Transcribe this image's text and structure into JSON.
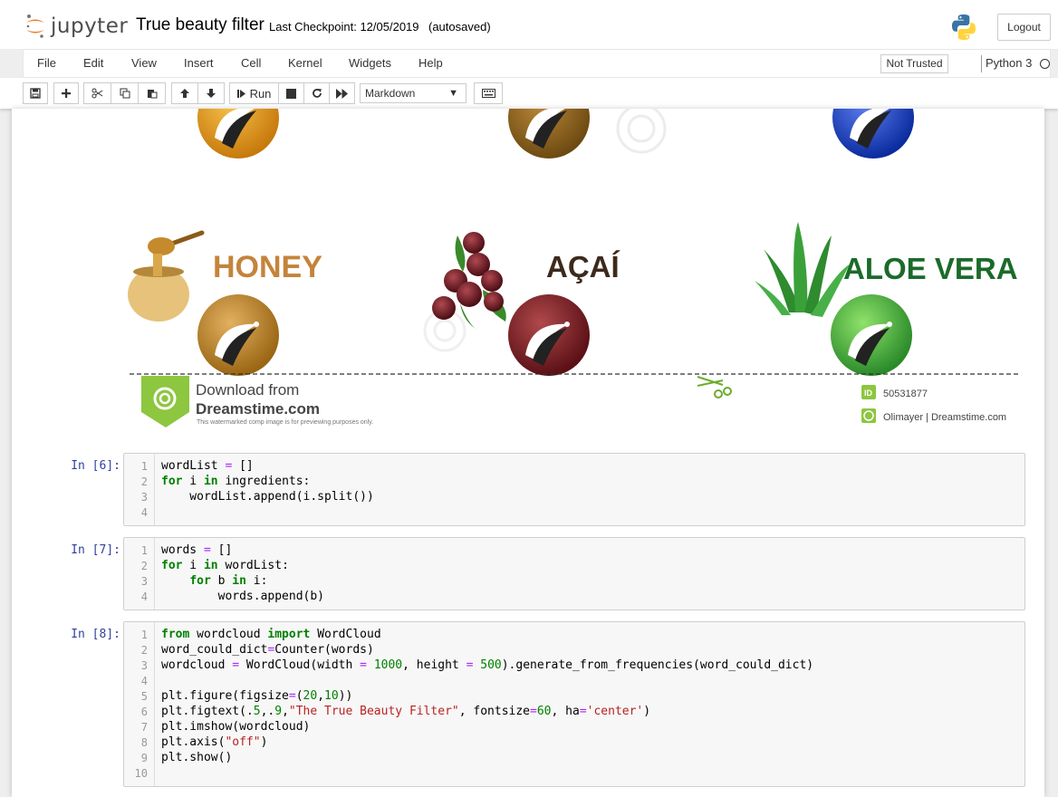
{
  "header": {
    "logo_text": "jupyter",
    "notebook_title": "True beauty filter",
    "checkpoint": "Last Checkpoint: 12/05/2019",
    "autosave": "(autosaved)",
    "logout_label": "Logout"
  },
  "menubar": {
    "items": [
      "File",
      "Edit",
      "View",
      "Insert",
      "Cell",
      "Kernel",
      "Widgets",
      "Help"
    ],
    "trust_label": "Not Trusted",
    "kernel_name": "Python 3"
  },
  "toolbar": {
    "run_label": "Run",
    "cell_type": "Markdown",
    "icons": [
      "save-icon",
      "plus-icon",
      "cut-icon",
      "copy-icon",
      "paste-icon",
      "arrow-up-icon",
      "arrow-down-icon",
      "run-icon",
      "stop-icon",
      "restart-icon",
      "fast-forward-icon",
      "keyboard-icon"
    ]
  },
  "output_image": {
    "labels": [
      "HONEY",
      "AÇAÍ",
      "ALOE VERA"
    ],
    "download_line1": "Download from",
    "download_line2": "Dreamstime.com",
    "download_note": "This watermarked comp image is for previewing purposes only.",
    "image_id": "50531877",
    "credit": "Olimayer | Dreamstime.com",
    "colors": {
      "honey": "#e8a220",
      "acai": "#7a1e22",
      "aloe": "#3fae3f",
      "brand": "#8dc63f"
    }
  },
  "cells": [
    {
      "prompt": "In [6]:",
      "lines": [
        "wordList = []",
        "for i in ingredients:",
        "    wordList.append(i.split())",
        ""
      ]
    },
    {
      "prompt": "In [7]:",
      "lines": [
        "words = []",
        "for i in wordList:",
        "    for b in i:",
        "        words.append(b)"
      ]
    },
    {
      "prompt": "In [8]:",
      "lines": [
        "from wordcloud import WordCloud",
        "word_could_dict=Counter(words)",
        "wordcloud = WordCloud(width = 1000, height = 500).generate_from_frequencies(word_could_dict)",
        "",
        "plt.figure(figsize=(20,10))",
        "plt.figtext(.5,.9,\"The True Beauty Filter\", fontsize=60, ha='center')",
        "plt.imshow(wordcloud)",
        "plt.axis(\"off\")",
        "plt.show()",
        ""
      ]
    }
  ]
}
